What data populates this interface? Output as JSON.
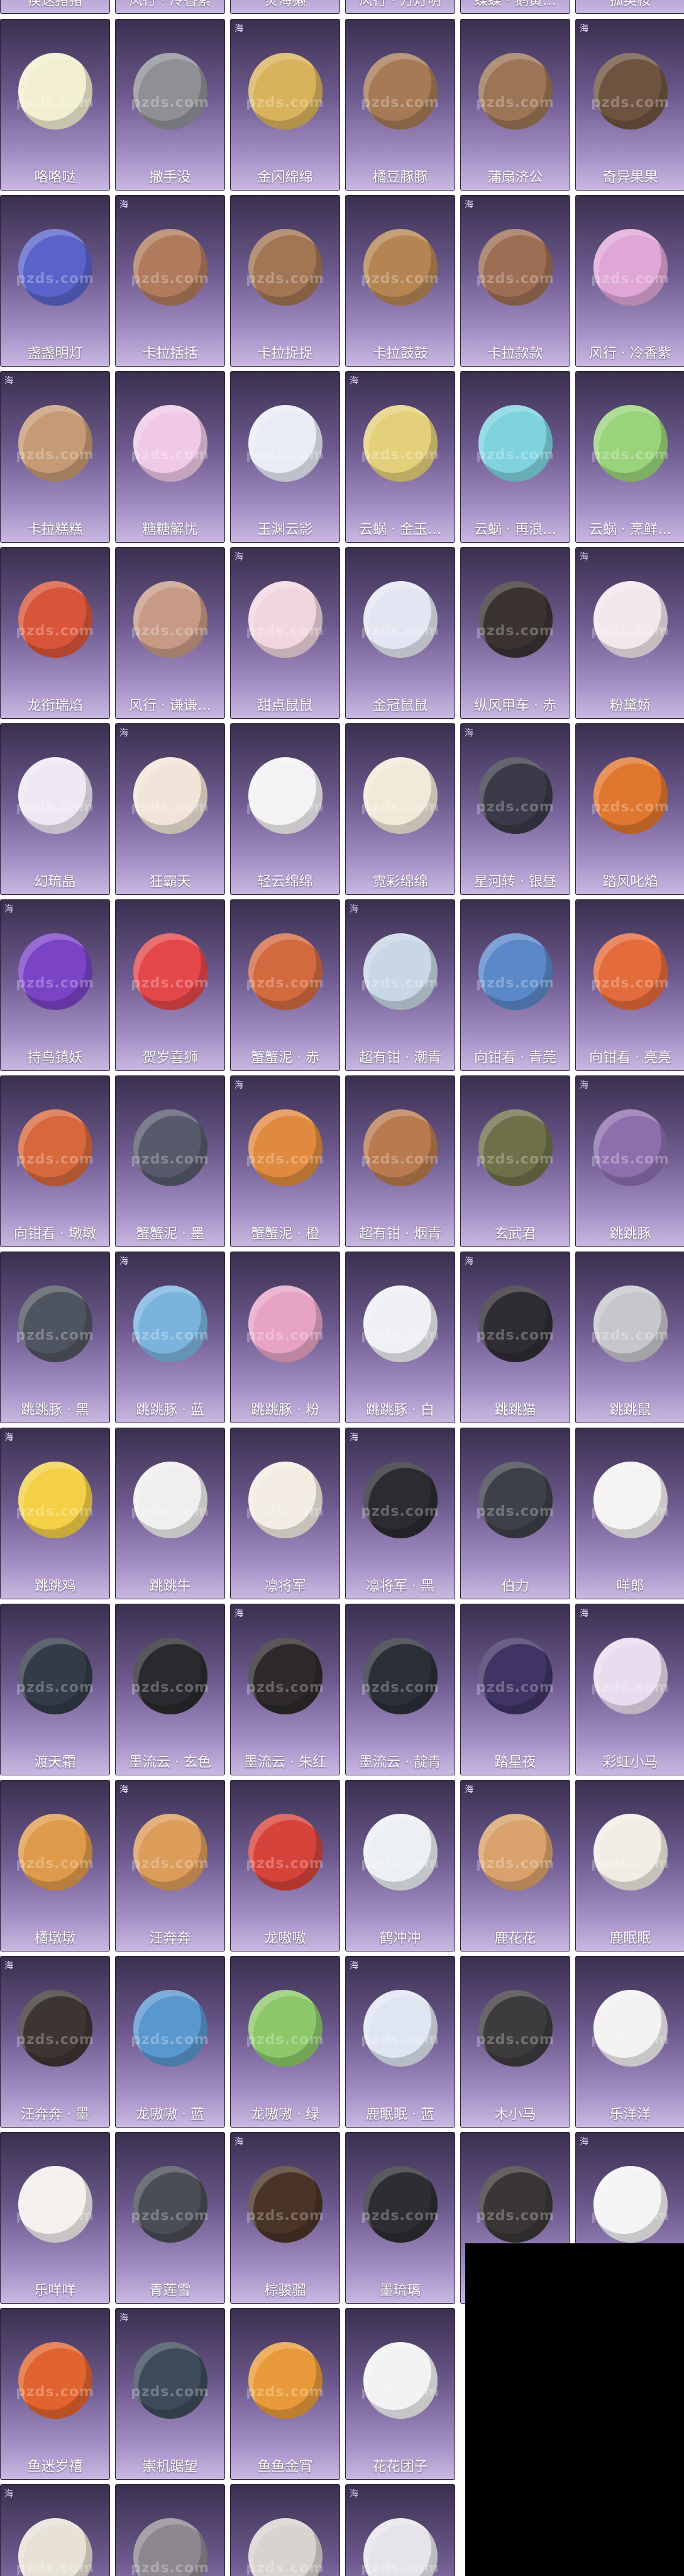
{
  "watermark": "pzds.com",
  "tag_text": "海",
  "rows": [
    [
      {
        "label": "疾速猪猪",
        "icon": "pet-icon",
        "color": "#b7a3cf"
      },
      {
        "label": "风行 · 冷香紫",
        "icon": "pet-icon",
        "color": "#a892c8"
      },
      {
        "label": "炎海獭",
        "icon": "pet-icon",
        "color": "#9b8ab8"
      },
      {
        "label": "风行 · 万灯明",
        "icon": "pet-icon",
        "color": "#a392c0"
      },
      {
        "label": "蝶蝶 · 鹅黄…",
        "icon": "pet-icon",
        "color": "#c3b08e"
      },
      {
        "label": "孤英桉",
        "icon": "pet-icon",
        "color": "#8c7bb0"
      }
    ],
    [
      {
        "label": "咯咯哒",
        "icon": "chick-icon",
        "color": "#f2efd0"
      },
      {
        "label": "撒手没",
        "icon": "husky-icon",
        "color": "#8f9096"
      },
      {
        "label": "金闪绵绵",
        "icon": "sheep-icon",
        "color": "#d9b25c"
      },
      {
        "label": "橘豆豚豚",
        "icon": "capybara-icon",
        "color": "#a57a55"
      },
      {
        "label": "蒲扇济公",
        "icon": "capybara-icon",
        "color": "#9c7456"
      },
      {
        "label": "奇异果果",
        "icon": "capybara-icon",
        "color": "#6e5440"
      }
    ],
    [
      {
        "label": "盏盏明灯",
        "icon": "lantern-pet-icon",
        "color": "#5a63c9"
      },
      {
        "label": "卡拉括括",
        "icon": "capybara-icon",
        "color": "#b07b5c"
      },
      {
        "label": "卡拉捉捉",
        "icon": "capybara-icon",
        "color": "#a27553"
      },
      {
        "label": "卡拉鼓鼓",
        "icon": "capybara-icon",
        "color": "#b48552"
      },
      {
        "label": "卡拉款款",
        "icon": "capybara-icon",
        "color": "#9d6e54"
      },
      {
        "label": "风行 · 冷香紫",
        "icon": "scooter-icon",
        "color": "#e0a6d6"
      }
    ],
    [
      {
        "label": "卡拉糕糕",
        "icon": "capybara-icon",
        "color": "#c69a75"
      },
      {
        "label": "糖糖解忧",
        "icon": "lion-dance-icon",
        "color": "#f0c9e6"
      },
      {
        "label": "玉渊云影",
        "icon": "lion-dance-icon",
        "color": "#e9ecf7"
      },
      {
        "label": "云蜗 · 金玉…",
        "icon": "snail-icon",
        "color": "#e4d07a"
      },
      {
        "label": "云蜗 · 再浪…",
        "icon": "snail-icon",
        "color": "#7ed3df"
      },
      {
        "label": "云蜗 · 烹鲜…",
        "icon": "snail-icon",
        "color": "#9ad47a"
      }
    ],
    [
      {
        "label": "龙衔瑞焰",
        "icon": "dragon-icon",
        "color": "#d9553a"
      },
      {
        "label": "风行 · 谦谦…",
        "icon": "skateboard-icon",
        "color": "#c79a86"
      },
      {
        "label": "甜点鼠鼠",
        "icon": "mouse-icon",
        "color": "#f1d6df"
      },
      {
        "label": "金冠鼠鼠",
        "icon": "mouse-icon",
        "color": "#e3e6f2"
      },
      {
        "label": "纵风甲车 · 赤",
        "icon": "motorcycle-icon",
        "color": "#3b3232"
      },
      {
        "label": "粉黛娇",
        "icon": "alpaca-icon",
        "color": "#f3e6ec"
      }
    ],
    [
      {
        "label": "幻琉晶",
        "icon": "alpaca-icon",
        "color": "#eee8f4"
      },
      {
        "label": "狂霸天",
        "icon": "alpaca-icon",
        "color": "#f2e4d8"
      },
      {
        "label": "轻云绵绵",
        "icon": "alpaca-icon",
        "color": "#f4f2f4"
      },
      {
        "label": "霓彩绵绵",
        "icon": "alpaca-icon",
        "color": "#f1ead9"
      },
      {
        "label": "星河转 · 银昼",
        "icon": "horse-icon",
        "color": "#3a3a48"
      },
      {
        "label": "踏风叱焰",
        "icon": "fire-icon",
        "color": "#e0772f"
      }
    ],
    [
      {
        "label": "持鸟镇妖",
        "icon": "spirit-icon",
        "color": "#7b43c6"
      },
      {
        "label": "贺岁喜狮",
        "icon": "lion-dance-icon",
        "color": "#e3474a"
      },
      {
        "label": "蟹蟹泥 · 赤",
        "icon": "crab-icon",
        "color": "#d2693f"
      },
      {
        "label": "超有钳 · 潮青",
        "icon": "crab-icon",
        "color": "#c8d6e6"
      },
      {
        "label": "向钳看 · 青莞",
        "icon": "crab-icon",
        "color": "#5a88c9"
      },
      {
        "label": "向钳看 · 亮亮",
        "icon": "crab-icon",
        "color": "#e46b3b"
      }
    ],
    [
      {
        "label": "向钳看 · 墩墩",
        "icon": "crab-icon",
        "color": "#d7683c"
      },
      {
        "label": "蟹蟹泥 · 墨",
        "icon": "crab-icon",
        "color": "#565a6b"
      },
      {
        "label": "蟹蟹泥 · 橙",
        "icon": "crab-icon",
        "color": "#e08a3f"
      },
      {
        "label": "超有钳 · 烟青",
        "icon": "crab-icon",
        "color": "#b97a4f"
      },
      {
        "label": "玄武君",
        "icon": "turtle-icon",
        "color": "#6d7048"
      },
      {
        "label": "跳跳豚",
        "icon": "pufferfish-icon",
        "color": "#8e6fae"
      }
    ],
    [
      {
        "label": "跳跳豚 · 黑",
        "icon": "pufferfish-icon",
        "color": "#4f5560"
      },
      {
        "label": "跳跳豚 · 蓝",
        "icon": "pufferfish-icon",
        "color": "#7ab4de"
      },
      {
        "label": "跳跳豚 · 粉",
        "icon": "pufferfish-icon",
        "color": "#e6a3c4"
      },
      {
        "label": "跳跳豚 · 白",
        "icon": "pufferfish-icon",
        "color": "#eef0f4"
      },
      {
        "label": "跳跳猫",
        "icon": "cat-icon",
        "color": "#2f2c33"
      },
      {
        "label": "跳跳鼠",
        "icon": "mouse-icon",
        "color": "#c7c6cc"
      }
    ],
    [
      {
        "label": "跳跳鸡",
        "icon": "chick-icon",
        "color": "#f3d046"
      },
      {
        "label": "跳跳牛",
        "icon": "cow-icon",
        "color": "#f0eeee"
      },
      {
        "label": "凛将军",
        "icon": "goose-icon",
        "color": "#f2ece2"
      },
      {
        "label": "凛将军 · 黑",
        "icon": "goose-icon",
        "color": "#2b2b30"
      },
      {
        "label": "伯力",
        "icon": "husky-icon",
        "color": "#3d4048"
      },
      {
        "label": "咩郎",
        "icon": "dog-icon",
        "color": "#f4f2f2"
      }
    ],
    [
      {
        "label": "渡天霜",
        "icon": "horse-icon",
        "color": "#333a48"
      },
      {
        "label": "墨流云 · 玄色",
        "icon": "horse-icon",
        "color": "#2a2a2e"
      },
      {
        "label": "墨流云 · 朱红",
        "icon": "horse-icon",
        "color": "#2e2a2b"
      },
      {
        "label": "墨流云 · 靛青",
        "icon": "horse-icon",
        "color": "#2b2f38"
      },
      {
        "label": "踏星夜",
        "icon": "horse-icon",
        "color": "#3f3464"
      },
      {
        "label": "彩虹小马",
        "icon": "pony-icon",
        "color": "#e8dcef"
      }
    ],
    [
      {
        "label": "橘墩墩",
        "icon": "cat-icon",
        "color": "#e09a4c"
      },
      {
        "label": "汪奔奔",
        "icon": "dog-icon",
        "color": "#dc9c5a"
      },
      {
        "label": "龙嗷嗷",
        "icon": "dragon-icon",
        "color": "#d6433a"
      },
      {
        "label": "鹤冲冲",
        "icon": "crane-icon",
        "color": "#eceff4"
      },
      {
        "label": "鹿花花",
        "icon": "deer-icon",
        "color": "#d9a16c"
      },
      {
        "label": "鹿眠眠",
        "icon": "deer-icon",
        "color": "#f1ece4"
      }
    ],
    [
      {
        "label": "汪奔奔 · 墨",
        "icon": "dog-icon",
        "color": "#3d3533"
      },
      {
        "label": "龙嗷嗷 · 蓝",
        "icon": "dragon-icon",
        "color": "#5a97cf"
      },
      {
        "label": "龙嗷嗷 · 绿",
        "icon": "dragon-icon",
        "color": "#8cc86a"
      },
      {
        "label": "鹿眠眠 · 蓝",
        "icon": "deer-icon",
        "color": "#dfe6f2"
      },
      {
        "label": "木小马",
        "icon": "donkey-icon",
        "color": "#3e3b3f"
      },
      {
        "label": "乐洋洋",
        "icon": "sheep-icon",
        "color": "#f3f1f3"
      }
    ],
    [
      {
        "label": "乐咩咩",
        "icon": "sheep-icon",
        "color": "#f3f0ee"
      },
      {
        "label": "青莲雪",
        "icon": "horse-icon",
        "color": "#4a4c56"
      },
      {
        "label": "棕骏骝",
        "icon": "horse-icon",
        "color": "#4a3428"
      },
      {
        "label": "墨琉璃",
        "icon": "horse-icon",
        "color": "#2d2d33"
      },
      {
        "label": "",
        "icon": "horse-icon",
        "color": "#3a3636"
      },
      {
        "label": "",
        "icon": "cat-icon",
        "color": "#f4f3f5"
      }
    ],
    [
      {
        "label": "鱼迷岁禧",
        "icon": "koi-icon",
        "color": "#e1632f"
      },
      {
        "label": "崇机踞望",
        "icon": "mech-icon",
        "color": "#3e4b5a"
      },
      {
        "label": "鱼鱼金宵",
        "icon": "koi-icon",
        "color": "#e89a3a"
      },
      {
        "label": "花花团子",
        "icon": "panda-icon",
        "color": "#f2f2f4"
      }
    ],
    [
      {
        "label": "",
        "icon": "pet-icon",
        "color": "#e8e2d6"
      },
      {
        "label": "",
        "icon": "pet-icon",
        "color": "#8d8890"
      },
      {
        "label": "",
        "icon": "pet-icon",
        "color": "#d8d3cf"
      },
      {
        "label": "",
        "icon": "pet-icon",
        "color": "#e6e4e8"
      }
    ]
  ]
}
